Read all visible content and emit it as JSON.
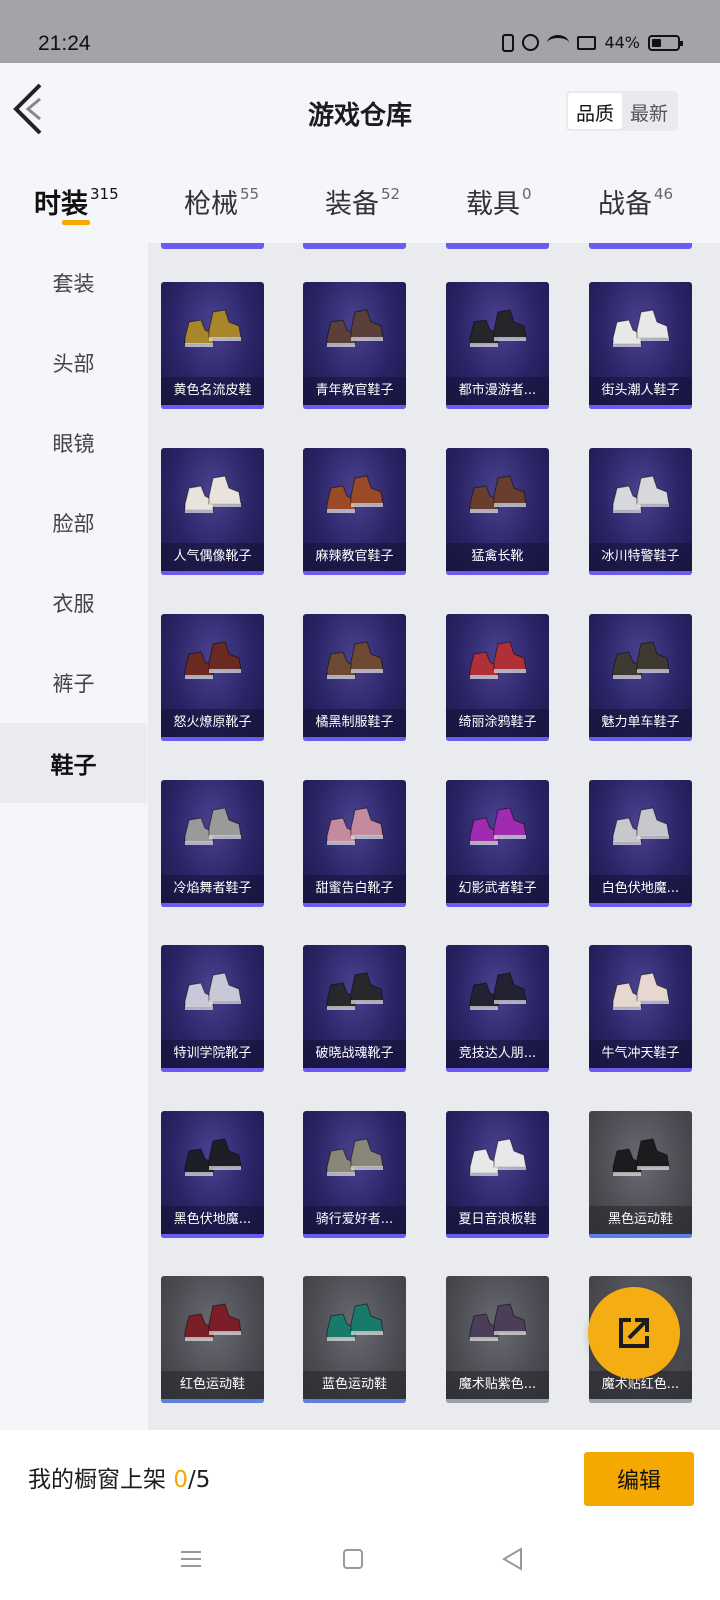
{
  "status_bar": {
    "time": "21:24",
    "battery": "44%"
  },
  "header": {
    "title": "游戏仓库",
    "sort_options": [
      "品质",
      "最新"
    ],
    "sort_selected": "品质"
  },
  "tabs": [
    {
      "label": "时装",
      "count": "315"
    },
    {
      "label": "枪械",
      "count": "55"
    },
    {
      "label": "装备",
      "count": "52"
    },
    {
      "label": "载具",
      "count": "0"
    },
    {
      "label": "战备",
      "count": "46"
    }
  ],
  "sidebar": [
    {
      "label": "套装"
    },
    {
      "label": "头部"
    },
    {
      "label": "眼镜"
    },
    {
      "label": "脸部"
    },
    {
      "label": "衣服"
    },
    {
      "label": "裤子"
    },
    {
      "label": "鞋子"
    }
  ],
  "items": [
    {
      "name": "黄色名流皮鞋",
      "color": "#a8862a"
    },
    {
      "name": "青年教官鞋子",
      "color": "#5a4038"
    },
    {
      "name": "都市漫游者...",
      "color": "#25252a"
    },
    {
      "name": "街头潮人鞋子",
      "color": "#e8e8e8"
    },
    {
      "name": "人气偶像靴子",
      "color": "#e8e4dc"
    },
    {
      "name": "麻辣教官鞋子",
      "color": "#9a4a26"
    },
    {
      "name": "猛禽长靴",
      "color": "#6a3e2e"
    },
    {
      "name": "冰川特警鞋子",
      "color": "#d6d8dc"
    },
    {
      "name": "怒火燎原靴子",
      "color": "#6a2a22"
    },
    {
      "name": "橘黑制服鞋子",
      "color": "#6e4a34"
    },
    {
      "name": "绮丽涂鸦鞋子",
      "color": "#b03038"
    },
    {
      "name": "魅力单车鞋子",
      "color": "#3e3a32"
    },
    {
      "name": "冷焰舞者鞋子",
      "color": "#9a9a9a"
    },
    {
      "name": "甜蜜告白靴子",
      "color": "#c48aa0"
    },
    {
      "name": "幻影武者鞋子",
      "color": "#a02ab0"
    },
    {
      "name": "白色伏地魔...",
      "color": "#c8c8cc"
    },
    {
      "name": "特训学院靴子",
      "color": "#c8c8d8"
    },
    {
      "name": "破晓战魂靴子",
      "color": "#28282c"
    },
    {
      "name": "竞技达人朋...",
      "color": "#222232"
    },
    {
      "name": "牛气冲天鞋子",
      "color": "#e6d8d0"
    },
    {
      "name": "黑色伏地魔...",
      "color": "#1e1e28"
    },
    {
      "name": "骑行爱好者...",
      "color": "#8a8678"
    },
    {
      "name": "夏日音浪板鞋",
      "color": "#e8e8ea"
    },
    {
      "name": "黑色运动鞋",
      "color": "#1c1c1e"
    },
    {
      "name": "红色运动鞋",
      "color": "#7a1e28"
    },
    {
      "name": "蓝色运动鞋",
      "color": "#1a7a6a"
    },
    {
      "name": "魔术贴紫色...",
      "color": "#4a3e58"
    },
    {
      "name": "魔术贴红色...",
      "color": "#6a2228"
    }
  ],
  "footer": {
    "showcase_label": "我的橱窗上架",
    "showcase_count": "0",
    "showcase_total": "/5",
    "edit_label": "编辑"
  },
  "colors": {
    "accent": "#f5a800",
    "card_bg": "#2a2466",
    "quality_bar": "#6a5cf0"
  }
}
